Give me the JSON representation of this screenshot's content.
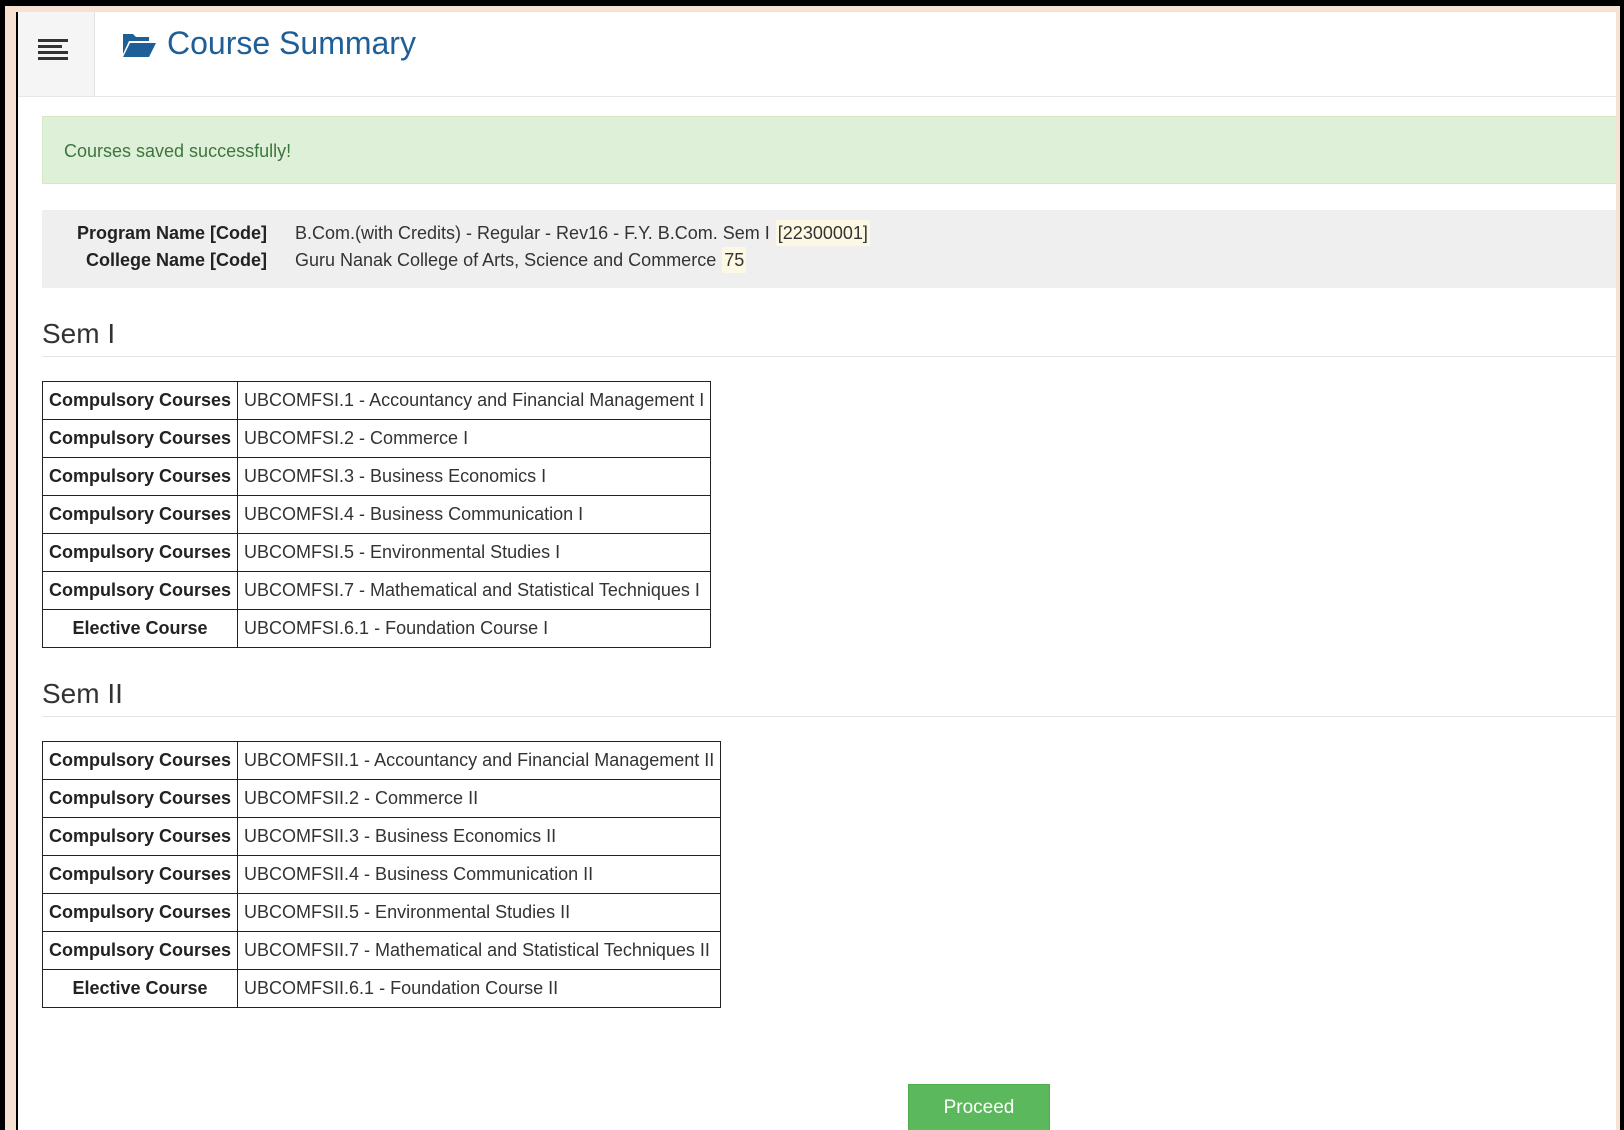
{
  "header": {
    "menu_icon": "hamburger-menu-icon",
    "title_icon": "folder-open-icon",
    "title": "Course Summary",
    "accent_color": "#1f5f97"
  },
  "alert": {
    "message": "Courses saved successfully!",
    "background": "#dff0d8",
    "text_color": "#3c763d"
  },
  "info": {
    "program_label": "Program Name [Code]",
    "program_value": "B.Com.(with Credits) - Regular - Rev16 - F.Y. B.Com. Sem I",
    "program_code": "[22300001]",
    "college_label": "College Name [Code]",
    "college_value": "Guru Nanak College of Arts, Science and Commerce",
    "college_code": "75"
  },
  "semesters": [
    {
      "heading": "Sem I",
      "rows": [
        {
          "category": "Compulsory Courses",
          "course": "UBCOMFSI.1 - Accountancy and Financial Management I"
        },
        {
          "category": "Compulsory Courses",
          "course": "UBCOMFSI.2 - Commerce I"
        },
        {
          "category": "Compulsory Courses",
          "course": "UBCOMFSI.3 - Business Economics I"
        },
        {
          "category": "Compulsory Courses",
          "course": "UBCOMFSI.4 - Business Communication I"
        },
        {
          "category": "Compulsory Courses",
          "course": "UBCOMFSI.5 - Environmental Studies I"
        },
        {
          "category": "Compulsory Courses",
          "course": "UBCOMFSI.7 - Mathematical and Statistical Techniques I"
        },
        {
          "category": "Elective Course",
          "course": "UBCOMFSI.6.1 - Foundation Course I"
        }
      ]
    },
    {
      "heading": "Sem II",
      "rows": [
        {
          "category": "Compulsory Courses",
          "course": "UBCOMFSII.1 - Accountancy and Financial Management II"
        },
        {
          "category": "Compulsory Courses",
          "course": "UBCOMFSII.2 - Commerce II"
        },
        {
          "category": "Compulsory Courses",
          "course": "UBCOMFSII.3 - Business Economics II"
        },
        {
          "category": "Compulsory Courses",
          "course": "UBCOMFSII.4 - Business Communication II"
        },
        {
          "category": "Compulsory Courses",
          "course": "UBCOMFSII.5 - Environmental Studies II"
        },
        {
          "category": "Compulsory Courses",
          "course": "UBCOMFSII.7 - Mathematical and Statistical Techniques II"
        },
        {
          "category": "Elective Course",
          "course": "UBCOMFSII.6.1 - Foundation Course II"
        }
      ]
    }
  ],
  "actions": {
    "proceed_label": "Proceed",
    "proceed_color": "#5cb85c"
  }
}
